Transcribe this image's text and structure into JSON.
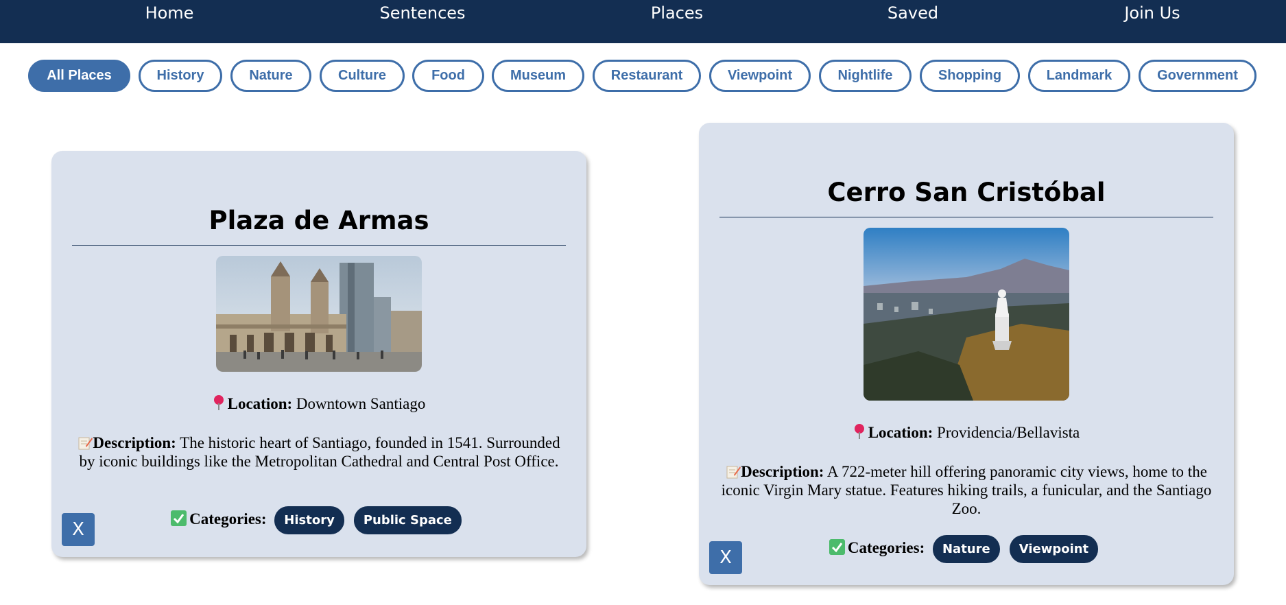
{
  "nav": {
    "items": [
      "Home",
      "Sentences",
      "Places",
      "Saved",
      "Join Us"
    ]
  },
  "filters": {
    "chips": [
      "All Places",
      "History",
      "Nature",
      "Culture",
      "Food",
      "Museum",
      "Restaurant",
      "Viewpoint",
      "Nightlife",
      "Shopping",
      "Landmark",
      "Government"
    ],
    "active": "All Places"
  },
  "cards": [
    {
      "title": "Plaza de Armas",
      "image_icon": "cathedral-photo",
      "location_label": "Location:",
      "location": "Downtown Santiago",
      "description_label": "Description:",
      "description": "The historic heart of Santiago, founded in 1541. Surrounded by iconic buildings like the Metropolitan Cathedral and Central Post Office.",
      "categories_label": "Categories:",
      "categories": [
        "History",
        "Public Space"
      ],
      "close_label": "X"
    },
    {
      "title": "Cerro San Cristóbal",
      "image_icon": "hill-statue-photo",
      "location_label": "Location:",
      "location": "Providencia/Bellavista",
      "description_label": "Description:",
      "description": "A 722-meter hill offering panoramic city views, home to the iconic Virgin Mary statue. Features hiking trails, a funicular, and the Santiago Zoo.",
      "categories_label": "Categories:",
      "categories": [
        "Nature",
        "Viewpoint"
      ],
      "close_label": "X"
    }
  ],
  "colors": {
    "nav_bg": "#132e52",
    "accent": "#3e6ea9",
    "card_bg": "#dae1ed",
    "tag_bg": "#132e52"
  }
}
